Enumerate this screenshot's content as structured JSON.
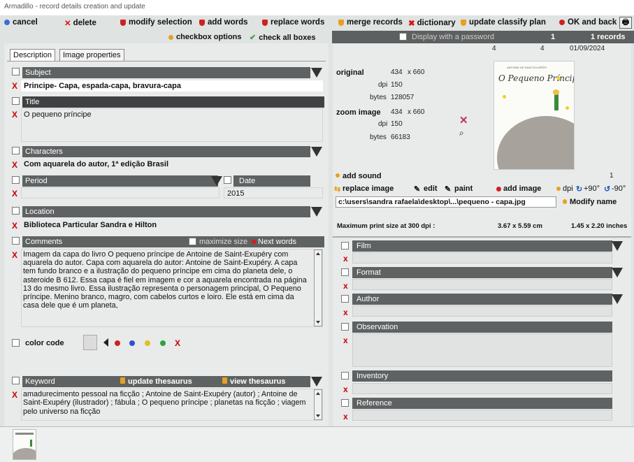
{
  "window": {
    "title": "Armadillo - record details creation and update"
  },
  "toolbar": {
    "cancel": "cancel",
    "delete": "delete",
    "modify_selection": "modify selection",
    "add_words": "add words",
    "replace_words": "replace words",
    "merge_records": "merge records",
    "dictionary": "dictionary",
    "update_classify_plan": "update classify plan",
    "ok_and_back": "OK and back"
  },
  "toolbar2": {
    "checkbox_options": "checkbox options",
    "check_all_boxes": "check all boxes",
    "display_password": "Display with a password",
    "record_index": "1",
    "records_count": "1 records"
  },
  "tabs": [
    "Description",
    "Image properties"
  ],
  "fields": {
    "subject": {
      "label": "Subject",
      "value": "Principe- Capa,  espada-capa, bravura-capa"
    },
    "title": {
      "label": "Title",
      "value": "O pequeno príncipe"
    },
    "characters": {
      "label": "Characters",
      "value": "Com aquarela do autor, 1ª edição Brasil"
    },
    "period": {
      "label": "Period",
      "value": ""
    },
    "date": {
      "label": "Date",
      "value": "2015"
    },
    "location": {
      "label": "Location",
      "value": "Biblioteca Particular Sandra e Hilton"
    },
    "comments": {
      "label": "Comments",
      "maximize": "maximize size",
      "next_words": "Next words",
      "text": "Imagem da capa do livro O pequeno príncipe de Antoine de Saint-Exupéry com aquarela do autor. Capa com aquarela do autor: Antoine de Saint-Exupéry. A capa tem fundo branco e a ilustração do pequeno príncipe em cima do planeta dele, o asteroide B 612. Essa capa é fiel em imagem e cor a aquarela encontrada na página 13 do mesmo livro. Essa ilustração representa o personagem principal, O Pequeno príncipe. Menino branco, magro, com cabelos curtos e loiro. Ele está em cima da casa dele que é um planeta,"
    },
    "color_code": {
      "label": "color code"
    },
    "keyword": {
      "label": "Keyword",
      "update_thesaurus": "update thesaurus",
      "view_thesaurus": "view thesaurus",
      "text": "amadurecimento pessoal na ficção ; Antoine de Saint-Exupéry (autor) ; Antoine de Saint-Exupéry (ilustrador) ; fábula ; O pequeno príncipe ; planetas na ficção ; viagem pelo universo na ficção"
    }
  },
  "image_info": {
    "top_a": "4",
    "top_b": "4",
    "date": "01/09/2024",
    "original": "original",
    "original_w": "434",
    "original_h": "x 660",
    "original_dpi_label": "dpi",
    "original_dpi": "150",
    "original_bytes_label": "bytes",
    "original_bytes": "128057",
    "zoom": "zoom image",
    "zoom_w": "434",
    "zoom_h": "x 660",
    "zoom_dpi_label": "dpi",
    "zoom_dpi": "150",
    "zoom_bytes_label": "bytes",
    "zoom_bytes": "66183",
    "add_sound": "add sound",
    "sound_count": "1",
    "replace_image": "replace image",
    "edit": "edit",
    "paint": "paint",
    "add_image": "add image",
    "dpi": "dpi",
    "rot_plus": "+90°",
    "rot_minus": "-90°",
    "path": "c:\\users\\sandra rafaela\\desktop\\...\\pequeno - capa.jpg",
    "modify_name": "Modify name",
    "print_label": "Maximum  print size at 300 dpi :",
    "print_cm": "3.67 x 5.59  cm",
    "print_in": "1.45 x 2.20 inches",
    "book_title": "O Pequeno Príncipe",
    "book_author": "ANTOINE DE SAINT-EXUPÉRY"
  },
  "right_fields": {
    "film": "Film",
    "format": "Format",
    "author": "Author",
    "observation": "Observation",
    "inventory": "Inventory",
    "reference": "Reference"
  },
  "colors": {
    "header": "#5f6263",
    "accent_red": "#cc0000",
    "panel": "#e8ebea"
  }
}
